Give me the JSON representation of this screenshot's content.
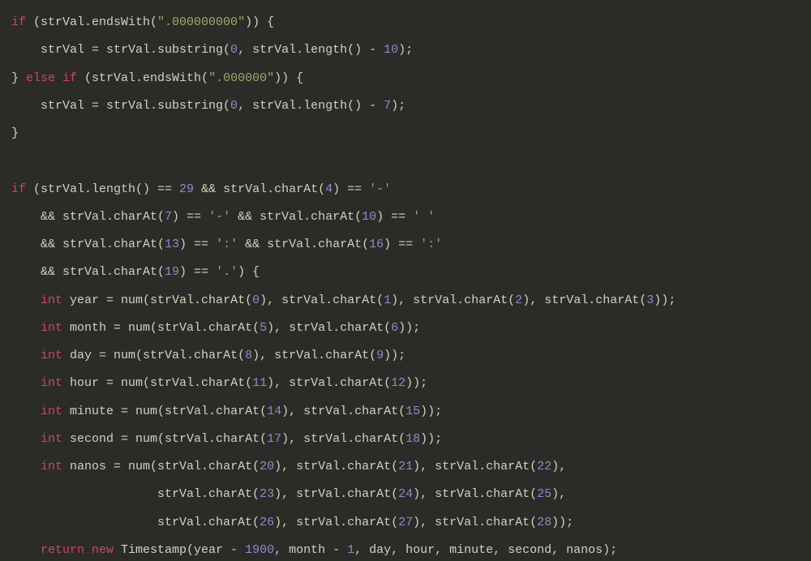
{
  "code": {
    "lines": [
      [
        [
          "kw",
          "if"
        ],
        [
          "id",
          " (strVal.endsWith("
        ],
        [
          "str",
          "\".000000000\""
        ],
        [
          "id",
          ")) {"
        ]
      ],
      [
        [
          "id",
          "    strVal = strVal.substring("
        ],
        [
          "num",
          "0"
        ],
        [
          "id",
          ", strVal.length() - "
        ],
        [
          "num",
          "10"
        ],
        [
          "id",
          ");"
        ]
      ],
      [
        [
          "id",
          "} "
        ],
        [
          "kw",
          "else if"
        ],
        [
          "id",
          " (strVal.endsWith("
        ],
        [
          "str",
          "\".000000\""
        ],
        [
          "id",
          ")) {"
        ]
      ],
      [
        [
          "id",
          "    strVal = strVal.substring("
        ],
        [
          "num",
          "0"
        ],
        [
          "id",
          ", strVal.length() - "
        ],
        [
          "num",
          "7"
        ],
        [
          "id",
          ");"
        ]
      ],
      [
        [
          "id",
          "}"
        ]
      ],
      [
        [
          "id",
          ""
        ]
      ],
      [
        [
          "kw",
          "if"
        ],
        [
          "id",
          " (strVal.length() == "
        ],
        [
          "num",
          "29"
        ],
        [
          "id",
          " && strVal.charAt("
        ],
        [
          "num",
          "4"
        ],
        [
          "id",
          ") == "
        ],
        [
          "str",
          "'-'"
        ]
      ],
      [
        [
          "id",
          "    && strVal.charAt("
        ],
        [
          "num",
          "7"
        ],
        [
          "id",
          ") == "
        ],
        [
          "str",
          "'-'"
        ],
        [
          "id",
          " && strVal.charAt("
        ],
        [
          "num",
          "10"
        ],
        [
          "id",
          ") == "
        ],
        [
          "str",
          "' '"
        ]
      ],
      [
        [
          "id",
          "    && strVal.charAt("
        ],
        [
          "num",
          "13"
        ],
        [
          "id",
          ") == "
        ],
        [
          "str",
          "':'"
        ],
        [
          "id",
          " && strVal.charAt("
        ],
        [
          "num",
          "16"
        ],
        [
          "id",
          ") == "
        ],
        [
          "str",
          "':'"
        ]
      ],
      [
        [
          "id",
          "    && strVal.charAt("
        ],
        [
          "num",
          "19"
        ],
        [
          "id",
          ") == "
        ],
        [
          "str",
          "'.'"
        ],
        [
          "id",
          ") {"
        ]
      ],
      [
        [
          "id",
          "    "
        ],
        [
          "kw",
          "int"
        ],
        [
          "id",
          " year = num(strVal.charAt("
        ],
        [
          "num",
          "0"
        ],
        [
          "id",
          "), strVal.charAt("
        ],
        [
          "num",
          "1"
        ],
        [
          "id",
          "), strVal.charAt("
        ],
        [
          "num",
          "2"
        ],
        [
          "id",
          "), strVal.charAt("
        ],
        [
          "num",
          "3"
        ],
        [
          "id",
          "));"
        ]
      ],
      [
        [
          "id",
          "    "
        ],
        [
          "kw",
          "int"
        ],
        [
          "id",
          " month = num(strVal.charAt("
        ],
        [
          "num",
          "5"
        ],
        [
          "id",
          "), strVal.charAt("
        ],
        [
          "num",
          "6"
        ],
        [
          "id",
          "));"
        ]
      ],
      [
        [
          "id",
          "    "
        ],
        [
          "kw",
          "int"
        ],
        [
          "id",
          " day = num(strVal.charAt("
        ],
        [
          "num",
          "8"
        ],
        [
          "id",
          "), strVal.charAt("
        ],
        [
          "num",
          "9"
        ],
        [
          "id",
          "));"
        ]
      ],
      [
        [
          "id",
          "    "
        ],
        [
          "kw",
          "int"
        ],
        [
          "id",
          " hour = num(strVal.charAt("
        ],
        [
          "num",
          "11"
        ],
        [
          "id",
          "), strVal.charAt("
        ],
        [
          "num",
          "12"
        ],
        [
          "id",
          "));"
        ]
      ],
      [
        [
          "id",
          "    "
        ],
        [
          "kw",
          "int"
        ],
        [
          "id",
          " minute = num(strVal.charAt("
        ],
        [
          "num",
          "14"
        ],
        [
          "id",
          "), strVal.charAt("
        ],
        [
          "num",
          "15"
        ],
        [
          "id",
          "));"
        ]
      ],
      [
        [
          "id",
          "    "
        ],
        [
          "kw",
          "int"
        ],
        [
          "id",
          " second = num(strVal.charAt("
        ],
        [
          "num",
          "17"
        ],
        [
          "id",
          "), strVal.charAt("
        ],
        [
          "num",
          "18"
        ],
        [
          "id",
          "));"
        ]
      ],
      [
        [
          "id",
          "    "
        ],
        [
          "kw",
          "int"
        ],
        [
          "id",
          " nanos = num(strVal.charAt("
        ],
        [
          "num",
          "20"
        ],
        [
          "id",
          "), strVal.charAt("
        ],
        [
          "num",
          "21"
        ],
        [
          "id",
          "), strVal.charAt("
        ],
        [
          "num",
          "22"
        ],
        [
          "id",
          "),"
        ]
      ],
      [
        [
          "id",
          "                    strVal.charAt("
        ],
        [
          "num",
          "23"
        ],
        [
          "id",
          "), strVal.charAt("
        ],
        [
          "num",
          "24"
        ],
        [
          "id",
          "), strVal.charAt("
        ],
        [
          "num",
          "25"
        ],
        [
          "id",
          "),"
        ]
      ],
      [
        [
          "id",
          "                    strVal.charAt("
        ],
        [
          "num",
          "26"
        ],
        [
          "id",
          "), strVal.charAt("
        ],
        [
          "num",
          "27"
        ],
        [
          "id",
          "), strVal.charAt("
        ],
        [
          "num",
          "28"
        ],
        [
          "id",
          "));"
        ]
      ],
      [
        [
          "id",
          "    "
        ],
        [
          "kw",
          "return new"
        ],
        [
          "id",
          " Timestamp(year - "
        ],
        [
          "num",
          "1900"
        ],
        [
          "id",
          ", month - "
        ],
        [
          "num",
          "1"
        ],
        [
          "id",
          ", day, hour, minute, second, nanos);"
        ]
      ],
      [
        [
          "id",
          "}"
        ]
      ]
    ]
  }
}
